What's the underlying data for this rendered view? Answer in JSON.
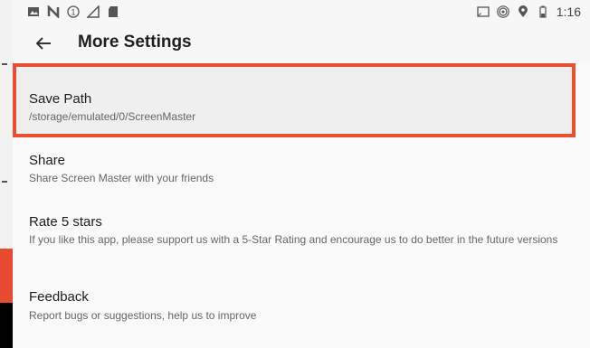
{
  "status_bar": {
    "time": "1:16",
    "left_icons": [
      "image-icon",
      "n-icon",
      "notification-1-icon",
      "signal-icon",
      "sd-card-icon"
    ],
    "right_icons": [
      "cast-icon",
      "hotspot-icon",
      "location-icon",
      "battery-icon"
    ]
  },
  "toolbar": {
    "title": "More Settings",
    "back_icon": "back-arrow-icon"
  },
  "settings": {
    "save_path": {
      "title": "Save Path",
      "subtitle": "/storage/emulated/0/ScreenMaster"
    },
    "share": {
      "title": "Share",
      "subtitle": "Share Screen Master with your friends"
    },
    "rate": {
      "title": "Rate 5 stars",
      "subtitle": "If you like this app, please support us with a 5-Star Rating and encourage us to do better in the future versions"
    },
    "feedback": {
      "title": "Feedback",
      "subtitle": "Report bugs or suggestions, help us to improve"
    }
  },
  "colors": {
    "highlight": "#e8502f",
    "background": "#fafafa"
  }
}
